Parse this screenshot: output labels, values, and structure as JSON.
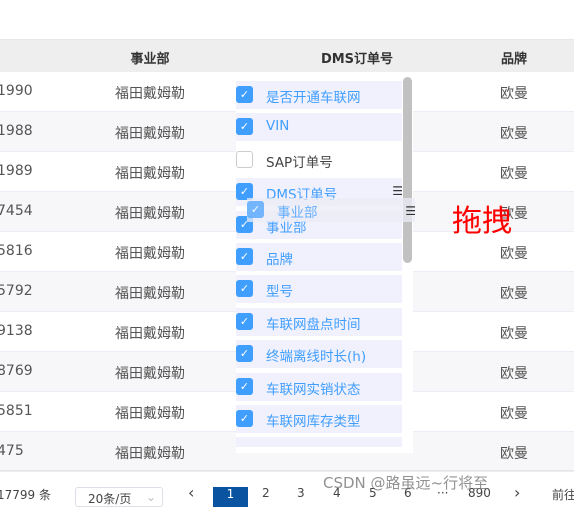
{
  "table": {
    "headers": [
      "事业部",
      "DMS订单号",
      "品牌"
    ],
    "rows": [
      [
        "1990",
        "福田戴姆勒",
        "欧曼"
      ],
      [
        "1988",
        "福田戴姆勒",
        "欧曼"
      ],
      [
        "1989",
        "福田戴姆勒",
        "欧曼"
      ],
      [
        "7454",
        "福田戴姆勒",
        "欧曼"
      ],
      [
        "5816",
        "福田戴姆勒",
        "欧曼"
      ],
      [
        "5792",
        "福田戴姆勒",
        "欧曼"
      ],
      [
        "9138",
        "福田戴姆勒",
        "欧曼"
      ],
      [
        "8769",
        "福田戴姆勒",
        "欧曼"
      ],
      [
        "5851",
        "福田戴姆勒",
        "欧曼"
      ],
      [
        "475",
        "福田戴姆勒",
        "欧曼"
      ]
    ]
  },
  "column_picker": {
    "items": [
      {
        "label": "是否开通车联网",
        "checked": true
      },
      {
        "label": "VIN",
        "checked": true
      },
      {
        "label": "SAP订单号",
        "checked": false
      },
      {
        "label": "DMS订单号",
        "checked": true
      },
      {
        "label": "事业部",
        "checked": true
      },
      {
        "label": "品牌",
        "checked": true
      },
      {
        "label": "型号",
        "checked": true
      },
      {
        "label": "车联网盘点时间",
        "checked": true
      },
      {
        "label": "终端离线时长(h)",
        "checked": true
      },
      {
        "label": "车联网实销状态",
        "checked": true
      },
      {
        "label": "车联网库存类型",
        "checked": true
      }
    ],
    "drag_ghost": "事业部",
    "accent": "#409eff"
  },
  "annotation": "拖拽",
  "pagination": {
    "total": "17799 条",
    "page_size": "20条/页",
    "prev": "‹",
    "pages": [
      "1",
      "2",
      "3",
      "4",
      "5",
      "6",
      "···",
      "890"
    ],
    "next": "›",
    "jump": "前往",
    "current": "1"
  },
  "watermark": "CSDN @路虽远~行将至"
}
